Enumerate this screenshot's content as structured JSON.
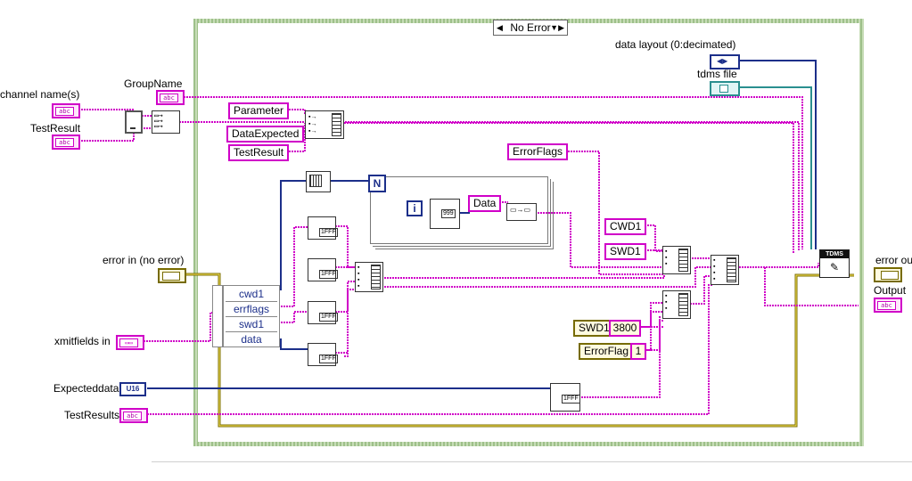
{
  "case_selector": {
    "label": "No Error"
  },
  "controls": {
    "group_name": "GroupName",
    "channel_names": "channel name(s)",
    "test_result": "TestResult",
    "error_in": "error in (no error)",
    "xmit_fields_in": "xmitfields in",
    "expected_data": "Expecteddata",
    "test_results": "TestResults"
  },
  "indicators": {
    "data_layout": "data layout (0:decimated)",
    "tdms_file": "tdms file",
    "error_out": "error ou",
    "output": "Output"
  },
  "constants": {
    "parameter": "Parameter",
    "data_expected": "DataExpected",
    "test_result": "TestResult",
    "error_flags": "ErrorFlags",
    "data": "Data",
    "cwd1": "CWD1",
    "swd1": "SWD1",
    "swd1_enum": "SWD1",
    "num_3800": "3800",
    "error_flag": "ErrorFlag",
    "num_1": "1"
  },
  "cluster_fields": [
    "cwd1",
    "errflags",
    "swd1",
    "data"
  ],
  "loop": {
    "count_terminal": "N",
    "index_terminal": "i"
  },
  "terminal_glyphs": {
    "string": "abc",
    "u16": "U16",
    "tdms": "TDMS",
    "fmt_999": "999",
    "fmt_1fff": "1FFF"
  },
  "colors": {
    "string_wire": "#d000c8",
    "numeric_wire": "#1c2f8a",
    "error_wire": "#776b00",
    "case_frame": "#9ec08a"
  }
}
